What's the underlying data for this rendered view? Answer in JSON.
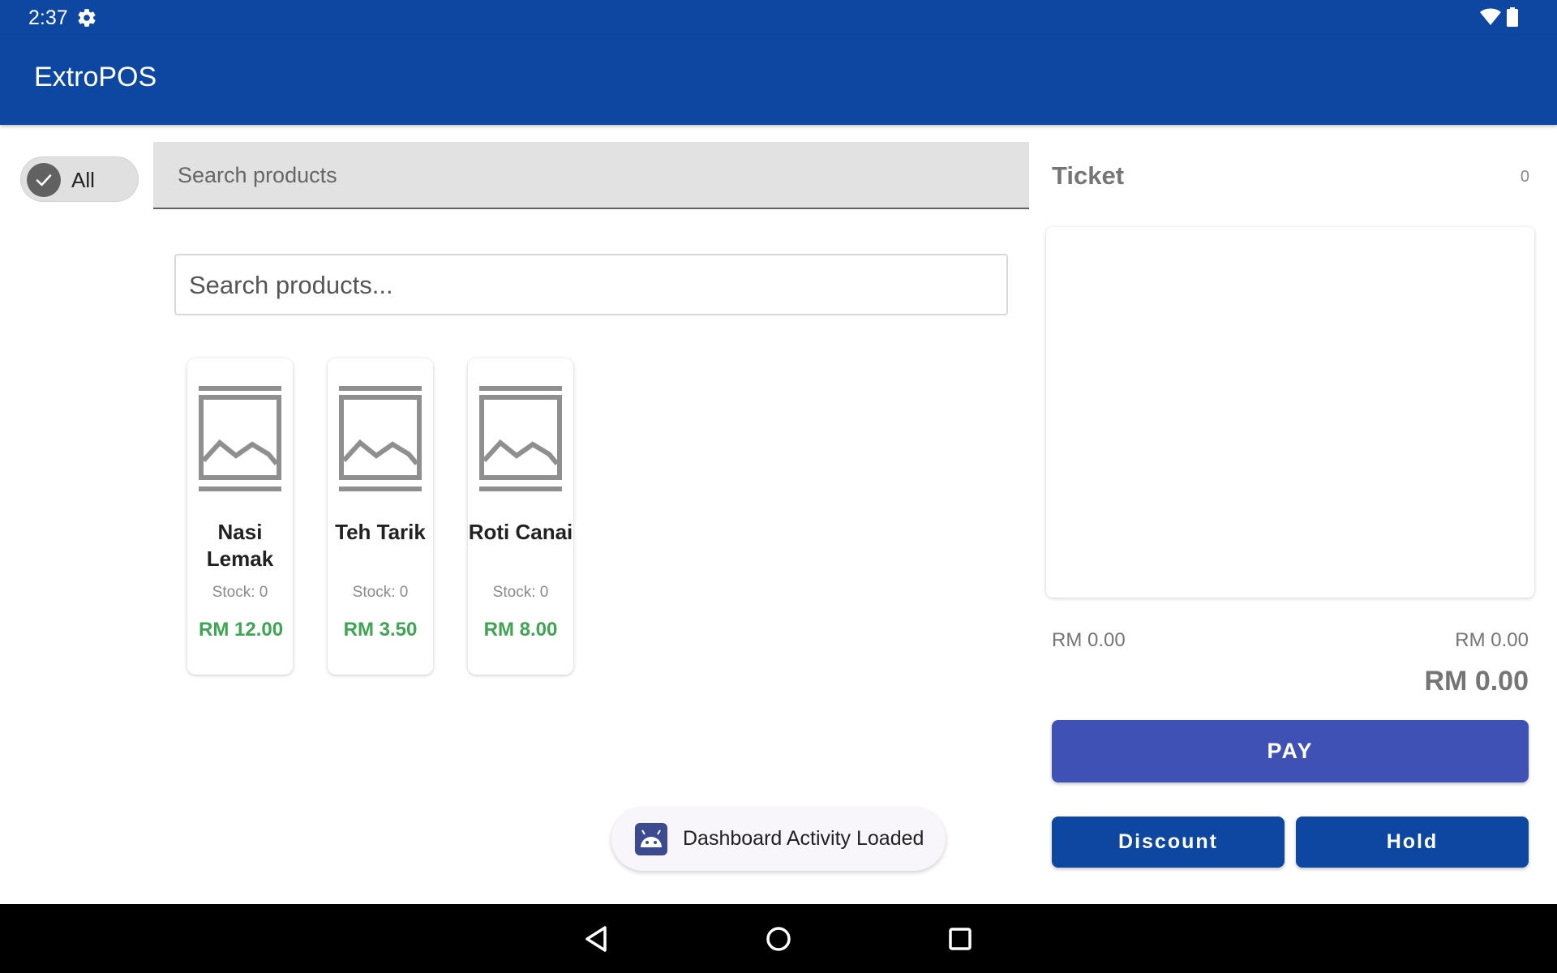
{
  "status_bar": {
    "time": "2:37",
    "icons": [
      "settings-icon",
      "wifi-icon",
      "battery-icon"
    ]
  },
  "app_bar": {
    "title": "ExtroPOS"
  },
  "category_chip": {
    "label": "All",
    "selected": true
  },
  "search_filled": {
    "placeholder": "Search products"
  },
  "search_outlined": {
    "placeholder": "Search products..."
  },
  "products": [
    {
      "name": "Nasi Lemak",
      "stock": "Stock: 0",
      "price": "RM 12.00",
      "image_icon": "image-placeholder-icon"
    },
    {
      "name": "Teh Tarik",
      "stock": "Stock: 0",
      "price": "RM 3.50",
      "image_icon": "image-placeholder-icon"
    },
    {
      "name": "Roti Canai",
      "stock": "Stock: 0",
      "price": "RM 8.00",
      "image_icon": "image-placeholder-icon"
    }
  ],
  "ticket": {
    "title": "Ticket",
    "count": "0",
    "subtotal_left": "RM 0.00",
    "subtotal_right": "RM 0.00",
    "total": "RM 0.00"
  },
  "buttons": {
    "pay": "PAY",
    "discount": "Discount",
    "hold": "Hold"
  },
  "toast": {
    "text": "Dashboard Activity Loaded",
    "icon": "android-icon"
  },
  "nav_bar": {
    "icons": [
      "back-icon",
      "home-icon",
      "recents-icon"
    ]
  },
  "colors": {
    "primary": "#0e47a1",
    "pay_button": "#3f51b5",
    "price_green": "#3ea552"
  }
}
